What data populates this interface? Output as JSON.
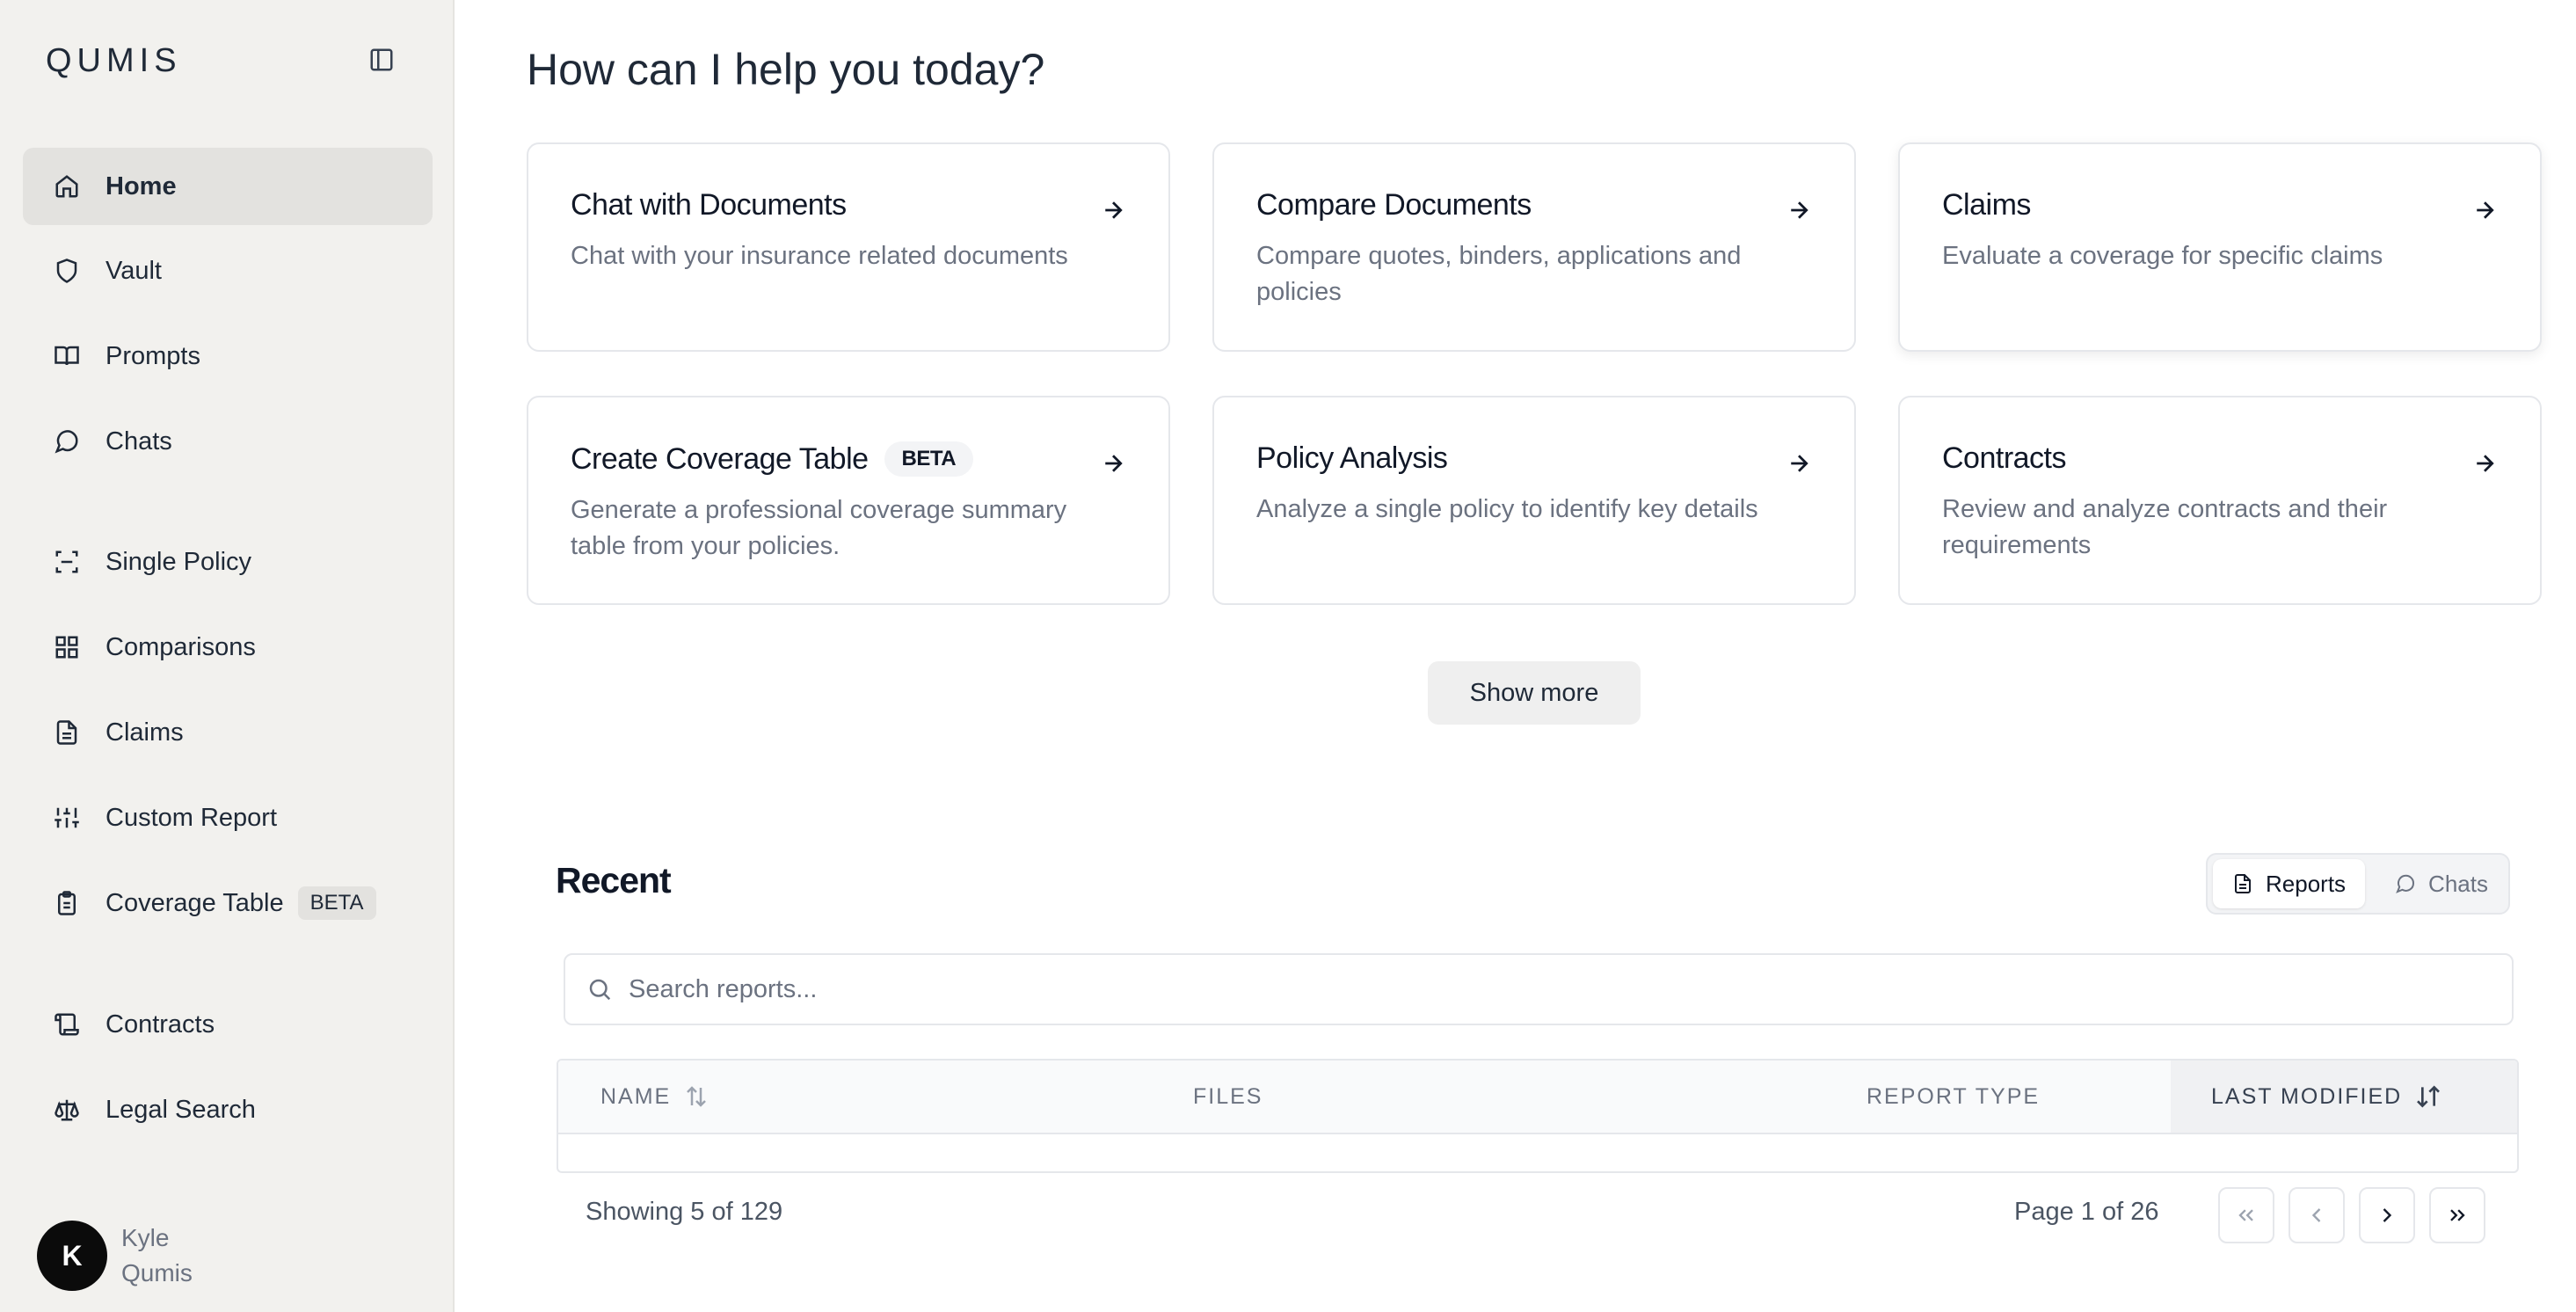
{
  "app": {
    "logo": "QUMIS"
  },
  "sidebar": {
    "items": [
      {
        "label": "Home",
        "icon": "home-icon",
        "active": true
      },
      {
        "label": "Vault",
        "icon": "shield-icon"
      },
      {
        "label": "Prompts",
        "icon": "book-icon"
      },
      {
        "label": "Chats",
        "icon": "chat-bubble-icon"
      },
      {
        "label": "Single Policy",
        "icon": "scan-icon"
      },
      {
        "label": "Comparisons",
        "icon": "grid-icon"
      },
      {
        "label": "Claims",
        "icon": "document-icon"
      },
      {
        "label": "Custom Report",
        "icon": "sliders-icon"
      },
      {
        "label": "Coverage Table",
        "icon": "clipboard-icon",
        "badge": "BETA"
      },
      {
        "label": "Contracts",
        "icon": "scroll-icon"
      },
      {
        "label": "Legal Search",
        "icon": "scale-icon"
      }
    ],
    "user": {
      "initial": "K",
      "first_name": "Kyle",
      "last_name": "Qumis"
    }
  },
  "main": {
    "heading": "How can I help you today?",
    "cards": [
      {
        "title": "Chat with Documents",
        "description": "Chat with your insurance related documents"
      },
      {
        "title": "Compare Documents",
        "description": "Compare quotes, binders, applications and policies"
      },
      {
        "title": "Claims",
        "description": "Evaluate a coverage for specific claims"
      },
      {
        "title": "Create Coverage Table",
        "badge": "BETA",
        "description": "Generate a professional coverage summary table from your policies."
      },
      {
        "title": "Policy Analysis",
        "description": "Analyze a single policy to identify key details"
      },
      {
        "title": "Contracts",
        "description": "Review and analyze contracts and their requirements"
      }
    ],
    "show_more": "Show more"
  },
  "recent": {
    "title": "Recent",
    "tabs": [
      {
        "label": "Reports",
        "icon": "document-icon",
        "active": true
      },
      {
        "label": "Chats",
        "icon": "chat-bubble-icon"
      }
    ],
    "search_placeholder": "Search reports...",
    "columns": [
      "Name",
      "Files",
      "Report Type",
      "Last Modified"
    ],
    "showing": "Showing 5 of 129",
    "page_indicator": "Page 1 of 26"
  },
  "colors": {
    "sidebar_bg": "#f2f1ee",
    "active_item": "#e3e2df",
    "text": "#111827",
    "muted": "#6b7280"
  }
}
